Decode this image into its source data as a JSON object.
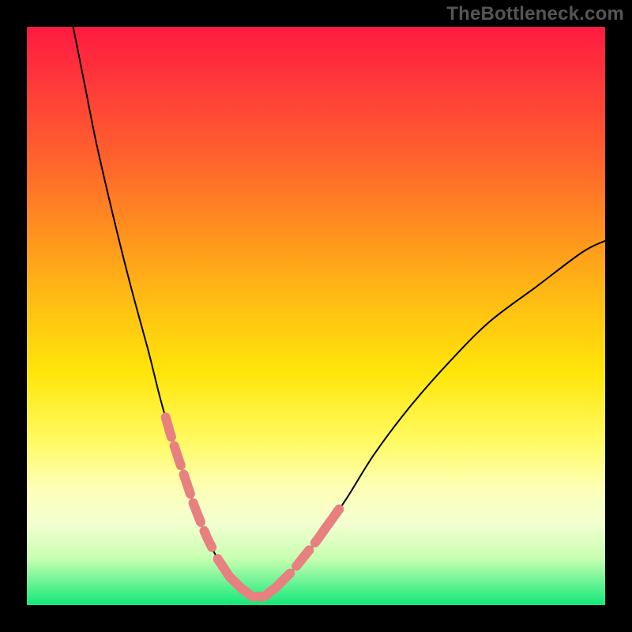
{
  "watermark": "TheBottleneck.com",
  "chart_data": {
    "type": "line",
    "title": "",
    "xlabel": "",
    "ylabel": "",
    "xlim": [
      0,
      100
    ],
    "ylim": [
      0,
      100
    ],
    "legend": false,
    "grid": false,
    "background": {
      "gradient": "vertical",
      "stops": [
        {
          "pos": 0.0,
          "color": "#ff1a40"
        },
        {
          "pos": 0.1,
          "color": "#ff3a3a"
        },
        {
          "pos": 0.25,
          "color": "#ff6a2a"
        },
        {
          "pos": 0.45,
          "color": "#ffb515"
        },
        {
          "pos": 0.6,
          "color": "#ffe60a"
        },
        {
          "pos": 0.72,
          "color": "#fffb66"
        },
        {
          "pos": 0.8,
          "color": "#fdffb8"
        },
        {
          "pos": 0.86,
          "color": "#f2ffd0"
        },
        {
          "pos": 0.92,
          "color": "#c6ffb0"
        },
        {
          "pos": 1.0,
          "color": "#12e87a"
        }
      ]
    },
    "series": [
      {
        "name": "bottleneck-curve",
        "color": "#000000",
        "x": [
          8,
          10,
          12,
          15,
          18,
          21,
          23,
          25,
          27,
          29,
          31,
          33,
          35,
          37,
          39,
          41,
          43,
          46,
          50,
          55,
          60,
          66,
          73,
          80,
          88,
          96,
          100
        ],
        "y": [
          100,
          90,
          80,
          67,
          55,
          44,
          36,
          29,
          23,
          17,
          12,
          8,
          5,
          3,
          1.5,
          1.5,
          3,
          6,
          11,
          18,
          26,
          34,
          42,
          49,
          55,
          61,
          63
        ]
      }
    ],
    "markers": [
      {
        "name": "left-arm-dashed",
        "style": "dashed",
        "color": "#e88080",
        "segment_x": [
          24,
          32
        ],
        "segment_y": [
          32,
          9
        ]
      },
      {
        "name": "trough-solid",
        "style": "solid",
        "color": "#e88080",
        "segment_x": [
          33,
          43
        ],
        "segment_y": [
          6,
          3
        ]
      },
      {
        "name": "right-arm-dashed",
        "style": "dashed",
        "color": "#e88080",
        "segment_x": [
          43,
          52
        ],
        "segment_y": [
          3,
          14
        ]
      },
      {
        "name": "right-arm-segment",
        "style": "solid",
        "color": "#e88080",
        "segment_x": [
          52,
          54
        ],
        "segment_y": [
          14,
          17
        ]
      }
    ],
    "annotations": []
  }
}
